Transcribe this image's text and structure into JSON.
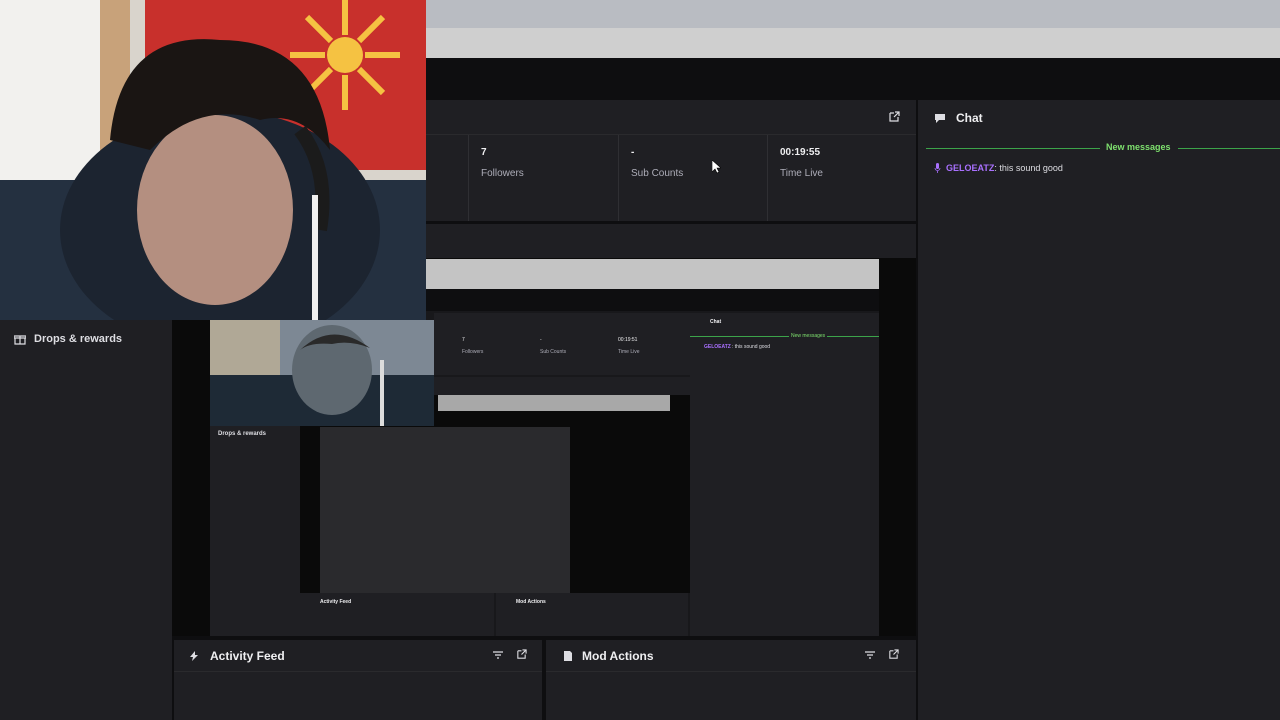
{
  "sidebar": {
    "drops_label": "Drops & rewards"
  },
  "stats": [
    {
      "value": "7",
      "label": "Followers"
    },
    {
      "value": "-",
      "label": "Sub Counts"
    },
    {
      "value": "00:19:55",
      "label": "Time Live"
    }
  ],
  "chat": {
    "title": "Chat",
    "new_messages": "New messages",
    "messages": [
      {
        "user": "GELOEATZ",
        "text": ": this sound good"
      }
    ]
  },
  "panels": {
    "activity_feed": "Activity Feed",
    "mod_actions": "Mod Actions"
  },
  "nested": {
    "stats": [
      {
        "value": "7",
        "label": "Followers"
      },
      {
        "value": "-",
        "label": "Sub Counts"
      },
      {
        "value": "00:19:51",
        "label": "Time Live"
      }
    ],
    "chat_title": "Chat",
    "new_messages": "New messages",
    "message_user": "GELOEATZ",
    "message_text": ": this sound good",
    "drops_label": "Drops & rewards",
    "activity_feed": "Activity Feed",
    "mod_actions": "Mod Actions"
  },
  "colors": {
    "accent_purple": "#a970ff",
    "new_messages_green": "#7ee06e",
    "panel_bg": "#1f1f23"
  }
}
